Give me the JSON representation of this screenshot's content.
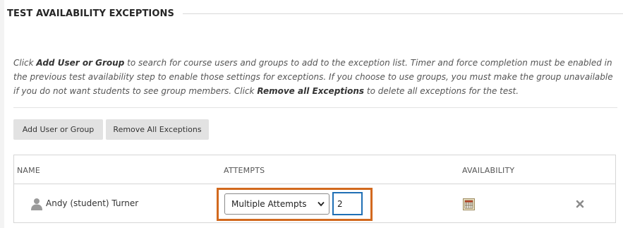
{
  "section": {
    "title": "TEST AVAILABILITY EXCEPTIONS"
  },
  "instructions": {
    "p1": "Click ",
    "add_bold": "Add User or Group",
    "p2": " to search for course users and groups to add to the exception list. Timer and force completion must be enabled in the previous test availability step to enable those settings for exceptions. If you choose to use groups, you must make the group unavailable if you do not want students to see group members. Click ",
    "remove_bold": "Remove all Exceptions",
    "p3": " to delete all exceptions for the test."
  },
  "buttons": {
    "add_user_or_group": "Add User or Group",
    "remove_all_exceptions": "Remove All Exceptions"
  },
  "table": {
    "headers": {
      "name": "NAME",
      "attempts": "ATTEMPTS",
      "availability": "AVAILABILITY"
    },
    "rows": [
      {
        "name": "Andy (student) Turner",
        "attempts_type": "Multiple Attempts",
        "attempts_count": "2"
      }
    ]
  },
  "icons": {
    "user": "user-icon",
    "availability": "calendar-icon",
    "remove": "close-icon",
    "dropdown": "chevron-down-icon"
  },
  "colors": {
    "highlight": "#d2691e",
    "input_focus": "#1f6fb5",
    "button_bg": "#e2e2e2"
  }
}
